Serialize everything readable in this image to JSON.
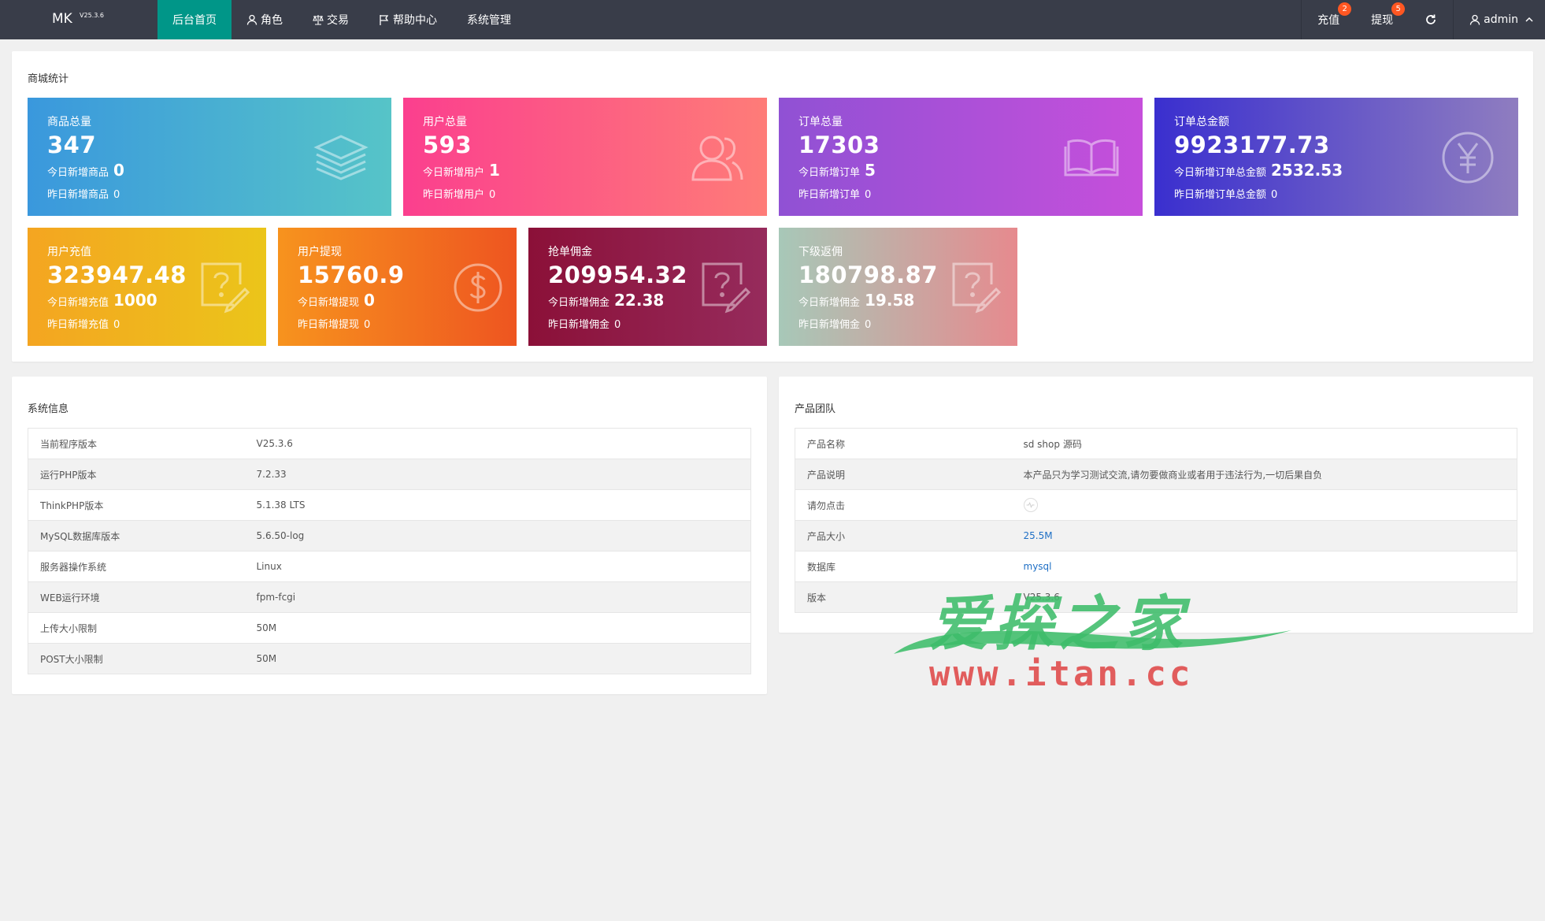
{
  "app": {
    "logo": "MK",
    "version": "V25.3.6"
  },
  "nav": {
    "items": [
      {
        "label": "后台首页",
        "icon": ""
      },
      {
        "label": "角色",
        "icon": "user-icon"
      },
      {
        "label": "交易",
        "icon": "scale-icon"
      },
      {
        "label": "帮助中心",
        "icon": "flag-icon"
      },
      {
        "label": "系统管理",
        "icon": ""
      }
    ],
    "recharge": {
      "label": "充值",
      "badge": "2"
    },
    "withdraw": {
      "label": "提现",
      "badge": "5"
    },
    "user": "admin"
  },
  "stats": {
    "title": "商城统计",
    "cards": [
      {
        "label": "商品总量",
        "value": "347",
        "today_label": "今日新增商品",
        "today": "0",
        "yday_label": "昨日新增商品",
        "yday": "0",
        "icon": "layers-icon"
      },
      {
        "label": "用户总量",
        "value": "593",
        "today_label": "今日新增用户",
        "today": "1",
        "yday_label": "昨日新增用户",
        "yday": "0",
        "icon": "users-icon"
      },
      {
        "label": "订单总量",
        "value": "17303",
        "today_label": "今日新增订单",
        "today": "5",
        "yday_label": "昨日新增订单",
        "yday": "0",
        "icon": "book-icon"
      },
      {
        "label": "订单总金额",
        "value": "9923177.73",
        "today_label": "今日新增订单总金额",
        "today": "2532.53",
        "yday_label": "昨日新增订单总金额",
        "yday": "0",
        "icon": "yen-icon"
      },
      {
        "label": "用户充值",
        "value": "323947.48",
        "today_label": "今日新增充值",
        "today": "1000",
        "yday_label": "昨日新增充值",
        "yday": "0",
        "icon": "question-edit-icon"
      },
      {
        "label": "用户提现",
        "value": "15760.9",
        "today_label": "今日新增提现",
        "today": "0",
        "yday_label": "昨日新增提现",
        "yday": "0",
        "icon": "dollar-icon"
      },
      {
        "label": "抢单佣金",
        "value": "209954.32",
        "today_label": "今日新增佣金",
        "today": "22.38",
        "yday_label": "昨日新增佣金",
        "yday": "0",
        "icon": "question-edit-icon"
      },
      {
        "label": "下级返佣",
        "value": "180798.87",
        "today_label": "今日新增佣金",
        "today": "19.58",
        "yday_label": "昨日新增佣金",
        "yday": "0",
        "icon": "question-edit-icon"
      }
    ]
  },
  "sysinfo": {
    "title": "系统信息",
    "rows": [
      {
        "k": "当前程序版本",
        "v": "V25.3.6"
      },
      {
        "k": "运行PHP版本",
        "v": "7.2.33"
      },
      {
        "k": "ThinkPHP版本",
        "v": "5.1.38 LTS"
      },
      {
        "k": "MySQL数据库版本",
        "v": "5.6.50-log"
      },
      {
        "k": "服务器操作系统",
        "v": "Linux"
      },
      {
        "k": "WEB运行环境",
        "v": "fpm-fcgi"
      },
      {
        "k": "上传大小限制",
        "v": "50M"
      },
      {
        "k": "POST大小限制",
        "v": "50M"
      }
    ]
  },
  "team": {
    "title": "产品团队",
    "rows": [
      {
        "k": "产品名称",
        "v": "sd shop 源码"
      },
      {
        "k": "产品说明",
        "v": "本产品只为学习测试交流,请勿要做商业或者用于违法行为,一切后果自负"
      },
      {
        "k": "请勿点击",
        "v": ""
      },
      {
        "k": "产品大小",
        "v": "25.5M"
      },
      {
        "k": "数据库",
        "v": "mysql"
      },
      {
        "k": "版本",
        "v": "V25.3.6"
      }
    ]
  },
  "watermark": {
    "cn": "爱探之家",
    "url": "www.itan.cc"
  },
  "colors": {
    "topbar": "#393d49",
    "active": "#009688",
    "badge": "#ff5722",
    "link": "#1e6fc5"
  }
}
